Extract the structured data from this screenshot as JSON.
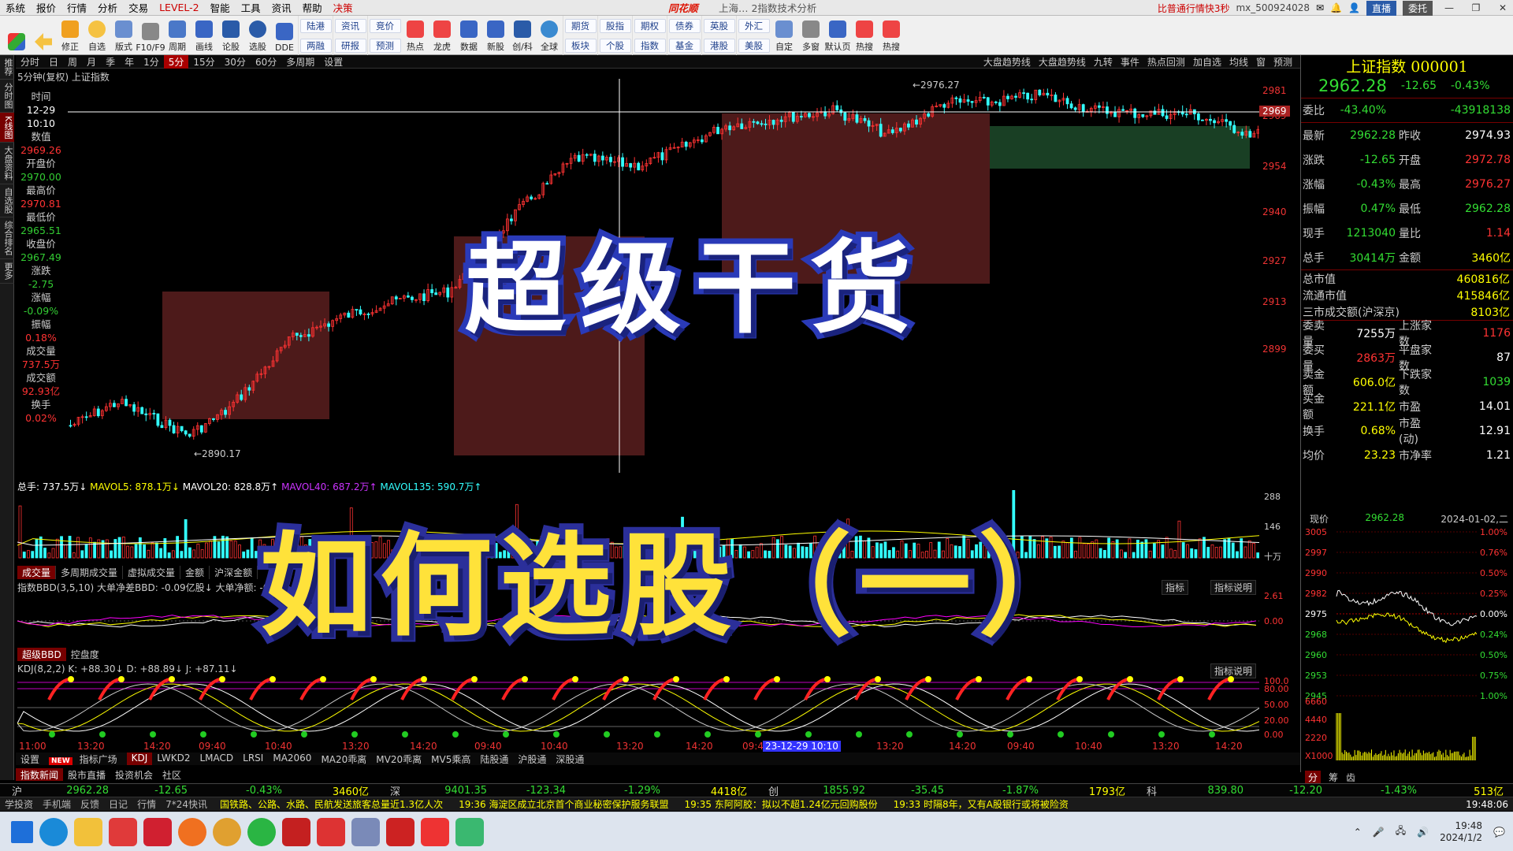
{
  "menu": {
    "items": [
      "系统",
      "报价",
      "行情",
      "分析",
      "交易",
      "LEVEL-2",
      "智能",
      "工具",
      "资讯",
      "帮助",
      "决策"
    ],
    "brand": "同花顺",
    "window_title": "上海… 2指数技术分析",
    "promo": "比普通行情快3秒",
    "account": "mx_500924028",
    "btn_live": "直播",
    "btn_entrust": "委托"
  },
  "toolbar": {
    "buttons": [
      "修正",
      "自选",
      "版式",
      "F10/F9",
      "周期",
      "画线",
      "论股",
      "选股",
      "DDE",
      "热点",
      "龙虎",
      "数据",
      "新股",
      "创/科",
      "全球",
      "自定",
      "多窗",
      "默认页",
      "热搜",
      "热搜"
    ],
    "pairs": [
      [
        "陆港",
        "两融"
      ],
      [
        "资讯",
        "研报"
      ],
      [
        "竞价",
        "预测"
      ],
      [
        "期货",
        "板块"
      ],
      [
        "股指",
        "个股"
      ],
      [
        "期权",
        "指数"
      ],
      [
        "债券",
        "基金"
      ],
      [
        "英股",
        "港股"
      ],
      [
        "外汇",
        "美股"
      ]
    ]
  },
  "lefttabs": [
    "推荐",
    "分时图",
    "K线图",
    "大盘资料",
    "自选股",
    "综合排名",
    "更多"
  ],
  "periodbar": {
    "items": [
      "分时",
      "日",
      "周",
      "月",
      "季",
      "年",
      "1分",
      "5分",
      "15分",
      "30分",
      "60分",
      "多周期",
      "设置"
    ],
    "active": "5分",
    "right_tools": [
      "大盘趋势线",
      "大盘趋势线",
      "九转",
      "事件",
      "热点回测",
      "加自选",
      "均线",
      "窗",
      "预测"
    ]
  },
  "chart_label": "5分钟(复权)  上证指数",
  "data_panel": [
    {
      "label": "时间",
      "value": "12-29"
    },
    {
      "label": "",
      "value": "10:10"
    },
    {
      "label": "数值",
      "value": "2969.26"
    },
    {
      "label": "开盘价",
      "value": "2970.00"
    },
    {
      "label": "最高价",
      "value": "2970.81"
    },
    {
      "label": "最低价",
      "value": "2965.51"
    },
    {
      "label": "收盘价",
      "value": "2967.49"
    },
    {
      "label": "涨跌",
      "value": "-2.75"
    },
    {
      "label": "涨幅",
      "value": "-0.09%"
    },
    {
      "label": "振幅",
      "value": "0.18%"
    },
    {
      "label": "成交量",
      "value": "737.5万"
    },
    {
      "label": "成交额",
      "value": "92.93亿"
    },
    {
      "label": "换手",
      "value": "0.02%"
    }
  ],
  "price_axis": [
    "2981",
    "2969",
    "2954",
    "2940",
    "2927",
    "2913",
    "2899"
  ],
  "annotations": {
    "high": "2976.27",
    "low": "2890.17"
  },
  "volume": {
    "header": [
      "总手: 737.5万↓",
      "MAVOL5: 878.1万↓",
      "MAVOL20: 828.8万↑",
      "MAVOL40: 687.2万↑",
      "MAVOL135: 590.7万↑"
    ],
    "axis": [
      "288",
      "146",
      "十万"
    ]
  },
  "tabs2": [
    "成交量",
    "多周期成交量",
    "虚拟成交量",
    "金额",
    "沪深金额"
  ],
  "bbd": {
    "header": "指数BBD(3,5,10) 大单净差BBD: -0.09亿股↓ 大单净额: -0.3",
    "axis": [
      "2.61",
      "0.00"
    ],
    "btn1": "指标",
    "btn2": "指标说明"
  },
  "tabs3": [
    "超级BBD",
    "控盘度"
  ],
  "kdj": {
    "header": "KDJ(8,2,2) K: +88.30↓ D: +88.89↓ J: +87.11↓",
    "axis": [
      "100.0",
      "80.00",
      "50.00",
      "20.00",
      "0.00"
    ],
    "btn": "指标说明"
  },
  "time_axis": [
    "11:00",
    "13:20",
    "14:20",
    "09:40",
    "10:40",
    "13:20",
    "14:20",
    "09:40",
    "10:40",
    "13:20",
    "14:20",
    "09:40",
    "23-12-29 10:10",
    "13:20",
    "14:20",
    "09:40",
    "10:40",
    "13:20",
    "14:20"
  ],
  "bottom_tabs": [
    "设置",
    "指标广场",
    "KDJ",
    "LWKD2",
    "LMACD",
    "LRSI",
    "MA2060",
    "MA20乖离",
    "MV20乖离",
    "MV5乘高",
    "陆股通",
    "沪股通",
    "深股通"
  ],
  "bottom_tabs2": [
    "指数新闻",
    "股市直播",
    "投资机会",
    "社区"
  ],
  "right_panel": {
    "title": "上证指数 000001",
    "price": "2962.28",
    "change": "-12.65",
    "pct": "-0.43%",
    "rows1": [
      {
        "l": "委比",
        "v1": "-43.40%",
        "l2": "",
        "v2": "-43918138"
      }
    ],
    "rows2": [
      {
        "l": "最新",
        "v1": "2962.28",
        "l2": "昨收",
        "v2": "2974.93"
      },
      {
        "l": "涨跌",
        "v1": "-12.65",
        "l2": "开盘",
        "v2": "2972.78"
      },
      {
        "l": "涨幅",
        "v1": "-0.43%",
        "l2": "最高",
        "v2": "2976.27"
      },
      {
        "l": "振幅",
        "v1": "0.47%",
        "l2": "最低",
        "v2": "2962.28"
      },
      {
        "l": "现手",
        "v1": "1213040",
        "l2": "量比",
        "v2": "1.14"
      },
      {
        "l": "总手",
        "v1": "30414万",
        "l2": "金额",
        "v2": "3460亿"
      }
    ],
    "rows3": [
      {
        "l": "总市值",
        "v": "460816亿"
      },
      {
        "l": "流通市值",
        "v": "415846亿"
      },
      {
        "l": "三市成交额(沪深京)",
        "v": "8103亿"
      }
    ],
    "rows4": [
      {
        "l": "委卖量",
        "v1": "7255万",
        "l2": "上涨家数",
        "v2": "1176"
      },
      {
        "l": "委买量",
        "v1": "2863万",
        "l2": "平盘家数",
        "v2": "87"
      },
      {
        "l": "卖金额",
        "v1": "606.0亿",
        "l2": "下跌家数",
        "v2": "1039"
      },
      {
        "l": "买金额",
        "v1": "221.1亿",
        "l2": "市盈",
        "v2": "14.01"
      },
      {
        "l": "换手",
        "v1": "0.68%",
        "l2": "市盈(动)",
        "v2": "12.91"
      },
      {
        "l": "均价",
        "v1": "23.23",
        "l2": "市净率",
        "v2": "1.21"
      }
    ],
    "mini": {
      "hdr_l": "现价",
      "hdr_v": "2962.28",
      "hdr_date": "2024-01-02,二",
      "axisL": [
        "3005",
        "2997",
        "2990",
        "2982",
        "2975",
        "2968",
        "2960",
        "2953",
        "2945",
        "6660",
        "4440",
        "2220",
        "X1000"
      ],
      "axisR": [
        "1.00%",
        "0.76%",
        "0.50%",
        "0.25%",
        "0.00%",
        "0.24%",
        "0.50%",
        "0.75%",
        "1.00%"
      ],
      "tabs": [
        "分",
        "筹",
        "齿"
      ]
    }
  },
  "index_bar": [
    {
      "n": "沪",
      "p": "2962.28",
      "c": "-12.65",
      "pct": "-0.43%",
      "amt": "3460亿"
    },
    {
      "n": "深",
      "p": "9401.35",
      "c": "-123.34",
      "pct": "-1.29%",
      "amt": "4418亿"
    },
    {
      "n": "创",
      "p": "1855.92",
      "c": "-35.45",
      "pct": "-1.87%",
      "amt": "1793亿"
    },
    {
      "n": "科",
      "p": "839.80",
      "c": "-12.20",
      "pct": "-1.43%",
      "amt": "513亿"
    }
  ],
  "news_bar": {
    "items": [
      "学投资",
      "手机端",
      "反馈",
      "日记",
      "行情",
      "7*24快讯"
    ],
    "news": [
      "国铁路、公路、水路、民航发送旅客总量近1.3亿人次",
      "19:36 海淀区成立北京首个商业秘密保护服务联盟",
      "19:35 东阿阿胶：拟以不超1.24亿元回购股份",
      "19:33 时隔8年，又有A股银行或将被险资"
    ],
    "time": "19:48:06"
  },
  "taskbar": {
    "time": "19:48",
    "date": "2024/1/2"
  },
  "overlay": {
    "line1": "超级干货",
    "line2": "如何选股（一）"
  },
  "colors": {
    "up": "#ff3333",
    "down": "#33dd33",
    "accent": "#ffff00",
    "box": "#5a1e1e"
  }
}
